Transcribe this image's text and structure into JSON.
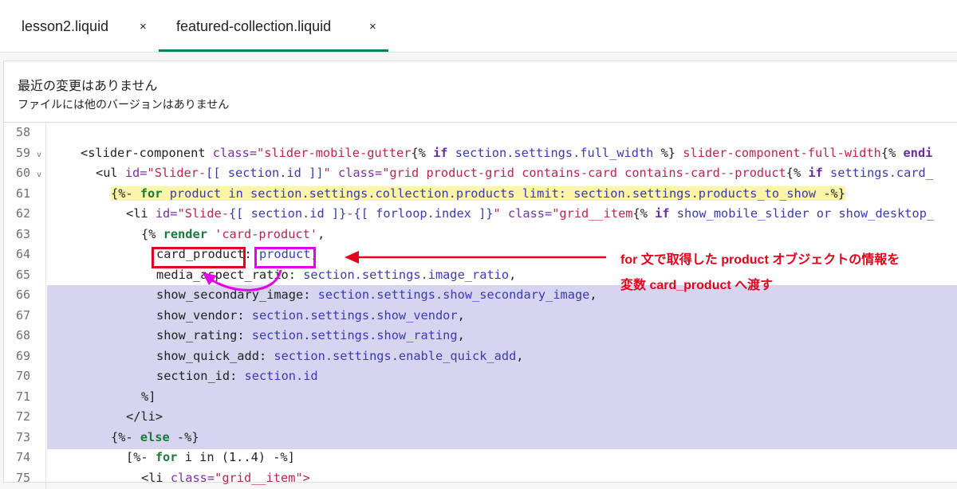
{
  "tabs": [
    {
      "label": "lesson2.liquid",
      "close": "×",
      "active": false
    },
    {
      "label": "featured-collection.liquid",
      "close": "×",
      "active": true
    }
  ],
  "notice": {
    "title": "最近の変更はありません",
    "subtitle": "ファイルには他のバージョンはありません"
  },
  "editor": {
    "lines": [
      {
        "n": "58"
      },
      {
        "n": "59",
        "fold": "v"
      },
      {
        "n": "60",
        "fold": "v"
      },
      {
        "n": "61"
      },
      {
        "n": "62"
      },
      {
        "n": "63"
      },
      {
        "n": "64"
      },
      {
        "n": "65"
      },
      {
        "n": "66"
      },
      {
        "n": "67"
      },
      {
        "n": "68"
      },
      {
        "n": "69"
      },
      {
        "n": "70"
      },
      {
        "n": "71"
      },
      {
        "n": "72"
      },
      {
        "n": "73"
      },
      {
        "n": "74"
      },
      {
        "n": "75"
      }
    ],
    "code": {
      "l59": [
        "<slider-component ",
        "class=",
        "\"slider-mobile-gutter",
        "{% ",
        "if",
        " section.settings.full_width ",
        "%}",
        " slider-component-full-width",
        "{% ",
        "endi"
      ],
      "l60": [
        "<ul ",
        "id=",
        "\"Slider-",
        "[[ section.id ]]",
        "\" ",
        "class=",
        "\"grid product-grid contains-card contains-card--product",
        "{% ",
        "if",
        " settings.card_"
      ],
      "l61": [
        "{%- ",
        "for",
        " product in section.settings.collection.products limit: section.settings.products_to_show ",
        "-%}"
      ],
      "l62": [
        "<li ",
        "id=",
        "\"Slide-",
        "{[ section.id ]}",
        "-",
        "{[ forloop.index ]}",
        "\" ",
        "class=",
        "\"grid__item",
        "{% ",
        "if",
        " show_mobile_slider or show_desktop_"
      ],
      "l63": [
        "{% ",
        "render",
        " 'card-product'",
        ","
      ],
      "l64": [
        "card_product",
        ": ",
        "product",
        ","
      ],
      "l65": [
        "media_aspect_ratio",
        ": ",
        "section.settings.image_ratio",
        ","
      ],
      "l66": [
        "show_secondary_image",
        ": ",
        "section.settings.show_secondary_image",
        ","
      ],
      "l67": [
        "show_vendor",
        ": ",
        "section.settings.show_vendor",
        ","
      ],
      "l68": [
        "show_rating",
        ": ",
        "section.settings.show_rating",
        ","
      ],
      "l69": [
        "show_quick_add",
        ": ",
        "section.settings.enable_quick_add",
        ","
      ],
      "l70": [
        "section_id",
        ": ",
        "section.id"
      ],
      "l71": [
        "%]"
      ],
      "l72": [
        "</li>"
      ],
      "l73": [
        "{%- ",
        "else",
        " -%}"
      ],
      "l74": [
        "[%- ",
        "for",
        " i in (1..4) ",
        "-%]"
      ],
      "l75": [
        "<li ",
        "class=",
        "\"grid__item",
        "\">"
      ]
    }
  },
  "annotation": {
    "line1": "for 文で取得した product オブジェクトの情報を",
    "line2": "変数 card_product へ渡す",
    "color": "#e3001b",
    "secondary_color": "#e400e6"
  }
}
